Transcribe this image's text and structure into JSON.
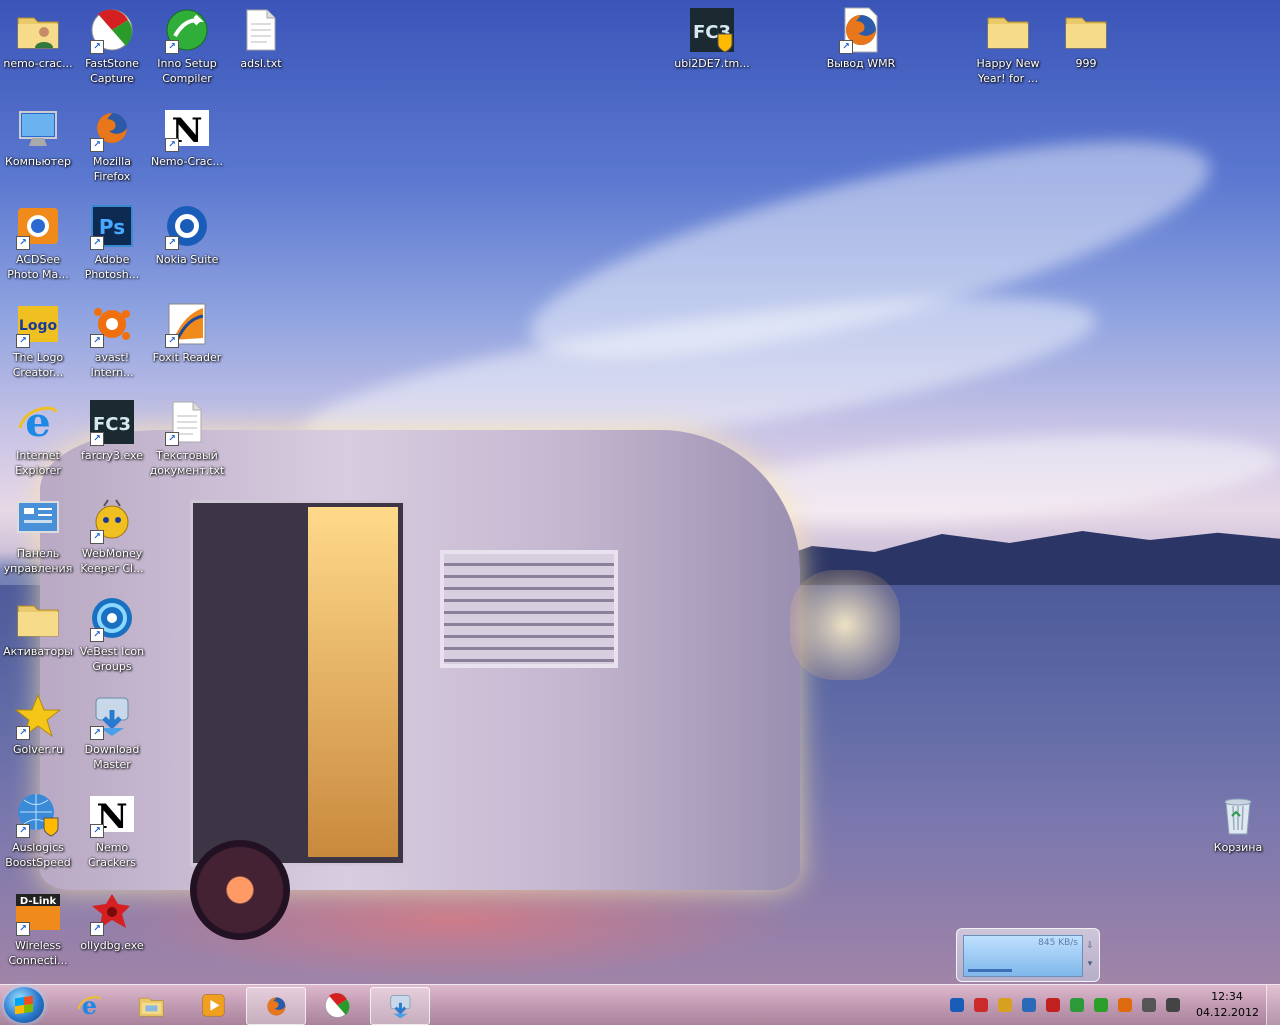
{
  "desktop": {
    "icons": [
      {
        "id": "nemo-crac",
        "label": "nemo-crac...",
        "kind": "folder-user",
        "shortcut": false
      },
      {
        "id": "faststone",
        "label": "FastStone\nCapture",
        "kind": "faststone",
        "shortcut": true
      },
      {
        "id": "inno",
        "label": "Inno Setup\nCompiler",
        "kind": "inno",
        "shortcut": true
      },
      {
        "id": "adsl",
        "label": "adsl.txt",
        "kind": "text-file",
        "shortcut": false
      },
      {
        "id": "ubi",
        "label": "ubi2DE7.tm...",
        "kind": "fc3-shield",
        "shortcut": false
      },
      {
        "id": "vyvod",
        "label": "Вывод WMR",
        "kind": "firefox-doc",
        "shortcut": true
      },
      {
        "id": "happy",
        "label": "Happy New\nYear! for ...",
        "kind": "folder",
        "shortcut": false
      },
      {
        "id": "n999",
        "label": "999",
        "kind": "folder",
        "shortcut": false
      },
      {
        "id": "computer",
        "label": "Компьютер",
        "kind": "computer",
        "shortcut": false
      },
      {
        "id": "firefox",
        "label": "Mozilla\nFirefox",
        "kind": "firefox",
        "shortcut": true
      },
      {
        "id": "nemo2",
        "label": "Nemo-Crac...",
        "kind": "nemo-n",
        "shortcut": true
      },
      {
        "id": "acdsee",
        "label": "ACDSee\nPhoto Ma...",
        "kind": "acdsee",
        "shortcut": true
      },
      {
        "id": "photoshop",
        "label": "Adobe\nPhotosh...",
        "kind": "photoshop",
        "shortcut": true
      },
      {
        "id": "nokia",
        "label": "Nokia Suite",
        "kind": "nokia",
        "shortcut": true
      },
      {
        "id": "logo",
        "label": "The Logo\nCreator...",
        "kind": "logo-creator",
        "shortcut": true
      },
      {
        "id": "avast",
        "label": "avast!\nIntern...",
        "kind": "avast",
        "shortcut": true
      },
      {
        "id": "foxit",
        "label": "Foxit Reader",
        "kind": "foxit",
        "shortcut": true
      },
      {
        "id": "ie",
        "label": "Internet\nExplorer",
        "kind": "ie",
        "shortcut": false
      },
      {
        "id": "farcry",
        "label": "farcry3.exe",
        "kind": "fc3",
        "shortcut": true
      },
      {
        "id": "textdoc",
        "label": "Текстовый\nдокумент.txt",
        "kind": "text-file",
        "shortcut": true
      },
      {
        "id": "panel",
        "label": "Панель\nуправления",
        "kind": "control-panel",
        "shortcut": false
      },
      {
        "id": "webmoney",
        "label": "WebMoney\nKeeper Cl...",
        "kind": "webmoney",
        "shortcut": true
      },
      {
        "id": "activators",
        "label": "Активаторы",
        "kind": "folder",
        "shortcut": false
      },
      {
        "id": "vebest",
        "label": "VeBest Icon\nGroups",
        "kind": "vebest",
        "shortcut": true
      },
      {
        "id": "golver",
        "label": "Golver.ru",
        "kind": "star",
        "shortcut": true
      },
      {
        "id": "dlmaster",
        "label": "Download\nMaster",
        "kind": "download-master",
        "shortcut": true
      },
      {
        "id": "auslogics",
        "label": "Auslogics\nBoostSpeed",
        "kind": "globe-shield",
        "shortcut": true
      },
      {
        "id": "nemocrackers",
        "label": "Nemo\nCrackers",
        "kind": "nemo-n",
        "shortcut": true
      },
      {
        "id": "dlink",
        "label": "Wireless\nConnecti...",
        "kind": "dlink",
        "shortcut": true
      },
      {
        "id": "olly",
        "label": "ollydbg.exe",
        "kind": "ollydbg",
        "shortcut": true
      },
      {
        "id": "recycle",
        "label": "Корзина",
        "kind": "recycle-bin",
        "shortcut": false
      }
    ]
  },
  "dlink_text": "D-Link",
  "netmeter": {
    "rate": "845 KB/s"
  },
  "taskbar": {
    "buttons": [
      {
        "id": "ie",
        "kind": "ie"
      },
      {
        "id": "explorer",
        "kind": "explorer"
      },
      {
        "id": "media",
        "kind": "media"
      },
      {
        "id": "firefox",
        "kind": "firefox",
        "active": true
      },
      {
        "id": "faststone",
        "kind": "faststone"
      },
      {
        "id": "dlmaster",
        "kind": "download-master",
        "active": true
      }
    ]
  },
  "tray": {
    "icons": [
      {
        "kind": "nokia",
        "color": "#1a5db8"
      },
      {
        "kind": "faststone",
        "color": "#cc2a2a"
      },
      {
        "kind": "webmoney",
        "color": "#d8a020"
      },
      {
        "kind": "network",
        "color": "#2a6ab8"
      },
      {
        "kind": "flag",
        "color": "#c02020"
      },
      {
        "kind": "shield",
        "color": "#2c9a38"
      },
      {
        "kind": "signal",
        "color": "#2aa02a"
      },
      {
        "kind": "avast",
        "color": "#e06a10"
      },
      {
        "kind": "wifi",
        "color": "#555"
      },
      {
        "kind": "volume",
        "color": "#444"
      }
    ]
  },
  "clock": {
    "time": "12:34",
    "date": "04.12.2012"
  }
}
